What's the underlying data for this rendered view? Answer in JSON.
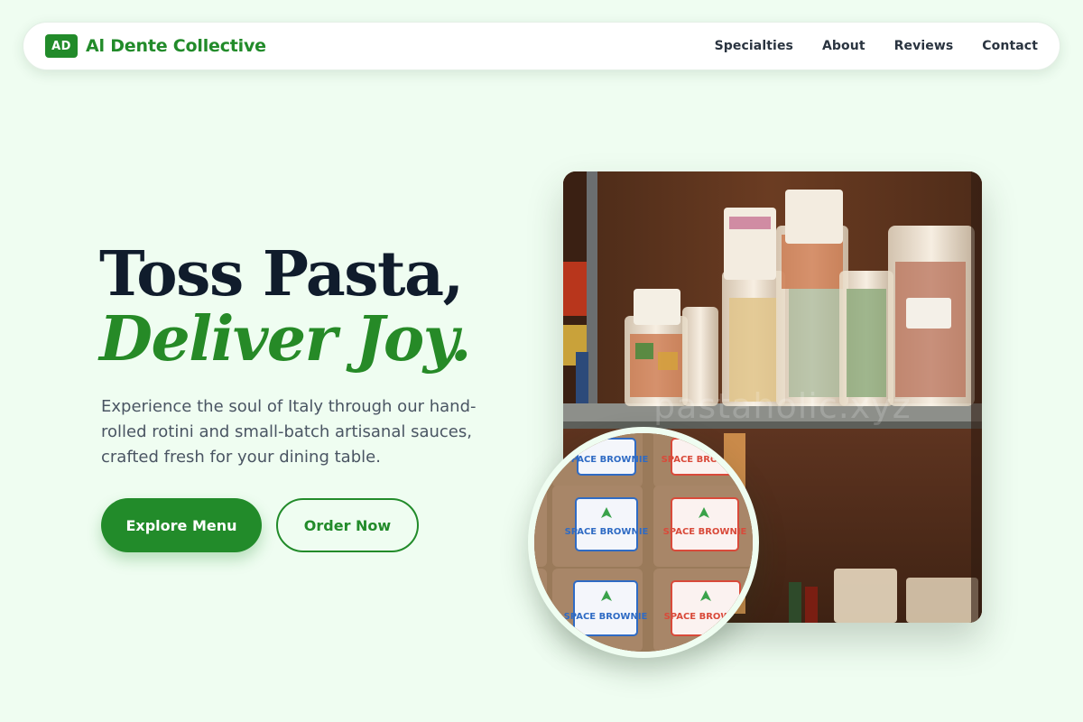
{
  "brand": {
    "badge": "AD",
    "name": "Al Dente Collective"
  },
  "nav": {
    "links": [
      "Specialties",
      "About",
      "Reviews",
      "Contact"
    ]
  },
  "hero": {
    "title_line1": "Toss Pasta,",
    "title_line2": "Deliver Joy.",
    "description": "Experience the soul of Italy through our hand-rolled rotini and small-batch artisanal sauces, crafted fresh for your dining table.",
    "primary_button": "Explore Menu",
    "secondary_button": "Order Now"
  },
  "photo": {
    "watermark": "pastaholic.xyz"
  },
  "inset": {
    "label_brand": "SPACE BROWNIE"
  },
  "colors": {
    "accent": "#228b2a",
    "background": "#effdf1",
    "heading": "#101c2c"
  }
}
